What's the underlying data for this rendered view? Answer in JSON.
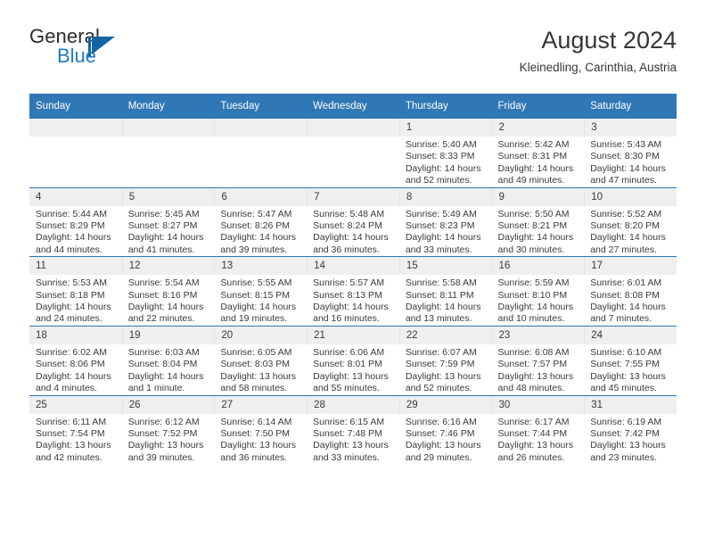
{
  "brand": {
    "name_top": "General",
    "name_bottom": "Blue",
    "logo_icon": "triangle-flag-icon",
    "accent_color": "#1f7ac4"
  },
  "header": {
    "title": "August 2024",
    "subtitle": "Kleinedling, Carinthia, Austria"
  },
  "theme": {
    "header_blue": "#3077b5",
    "daynum_gray": "#efefef",
    "text_color": "#3a3a3a"
  },
  "weekday_headers": [
    "Sunday",
    "Monday",
    "Tuesday",
    "Wednesday",
    "Thursday",
    "Friday",
    "Saturday"
  ],
  "labels": {
    "sunrise_prefix": "Sunrise:",
    "sunset_prefix": "Sunset:",
    "daylight_prefix": "Daylight:"
  },
  "weeks": [
    [
      {
        "day": "",
        "blank": true
      },
      {
        "day": "",
        "blank": true
      },
      {
        "day": "",
        "blank": true
      },
      {
        "day": "",
        "blank": true
      },
      {
        "day": "1",
        "sunrise": "Sunrise: 5:40 AM",
        "sunset": "Sunset: 8:33 PM",
        "daylight_l1": "Daylight: 14 hours",
        "daylight_l2": "and 52 minutes."
      },
      {
        "day": "2",
        "sunrise": "Sunrise: 5:42 AM",
        "sunset": "Sunset: 8:31 PM",
        "daylight_l1": "Daylight: 14 hours",
        "daylight_l2": "and 49 minutes."
      },
      {
        "day": "3",
        "sunrise": "Sunrise: 5:43 AM",
        "sunset": "Sunset: 8:30 PM",
        "daylight_l1": "Daylight: 14 hours",
        "daylight_l2": "and 47 minutes."
      }
    ],
    [
      {
        "day": "4",
        "sunrise": "Sunrise: 5:44 AM",
        "sunset": "Sunset: 8:29 PM",
        "daylight_l1": "Daylight: 14 hours",
        "daylight_l2": "and 44 minutes."
      },
      {
        "day": "5",
        "sunrise": "Sunrise: 5:45 AM",
        "sunset": "Sunset: 8:27 PM",
        "daylight_l1": "Daylight: 14 hours",
        "daylight_l2": "and 41 minutes."
      },
      {
        "day": "6",
        "sunrise": "Sunrise: 5:47 AM",
        "sunset": "Sunset: 8:26 PM",
        "daylight_l1": "Daylight: 14 hours",
        "daylight_l2": "and 39 minutes."
      },
      {
        "day": "7",
        "sunrise": "Sunrise: 5:48 AM",
        "sunset": "Sunset: 8:24 PM",
        "daylight_l1": "Daylight: 14 hours",
        "daylight_l2": "and 36 minutes."
      },
      {
        "day": "8",
        "sunrise": "Sunrise: 5:49 AM",
        "sunset": "Sunset: 8:23 PM",
        "daylight_l1": "Daylight: 14 hours",
        "daylight_l2": "and 33 minutes."
      },
      {
        "day": "9",
        "sunrise": "Sunrise: 5:50 AM",
        "sunset": "Sunset: 8:21 PM",
        "daylight_l1": "Daylight: 14 hours",
        "daylight_l2": "and 30 minutes."
      },
      {
        "day": "10",
        "sunrise": "Sunrise: 5:52 AM",
        "sunset": "Sunset: 8:20 PM",
        "daylight_l1": "Daylight: 14 hours",
        "daylight_l2": "and 27 minutes."
      }
    ],
    [
      {
        "day": "11",
        "sunrise": "Sunrise: 5:53 AM",
        "sunset": "Sunset: 8:18 PM",
        "daylight_l1": "Daylight: 14 hours",
        "daylight_l2": "and 24 minutes."
      },
      {
        "day": "12",
        "sunrise": "Sunrise: 5:54 AM",
        "sunset": "Sunset: 8:16 PM",
        "daylight_l1": "Daylight: 14 hours",
        "daylight_l2": "and 22 minutes."
      },
      {
        "day": "13",
        "sunrise": "Sunrise: 5:55 AM",
        "sunset": "Sunset: 8:15 PM",
        "daylight_l1": "Daylight: 14 hours",
        "daylight_l2": "and 19 minutes."
      },
      {
        "day": "14",
        "sunrise": "Sunrise: 5:57 AM",
        "sunset": "Sunset: 8:13 PM",
        "daylight_l1": "Daylight: 14 hours",
        "daylight_l2": "and 16 minutes."
      },
      {
        "day": "15",
        "sunrise": "Sunrise: 5:58 AM",
        "sunset": "Sunset: 8:11 PM",
        "daylight_l1": "Daylight: 14 hours",
        "daylight_l2": "and 13 minutes."
      },
      {
        "day": "16",
        "sunrise": "Sunrise: 5:59 AM",
        "sunset": "Sunset: 8:10 PM",
        "daylight_l1": "Daylight: 14 hours",
        "daylight_l2": "and 10 minutes."
      },
      {
        "day": "17",
        "sunrise": "Sunrise: 6:01 AM",
        "sunset": "Sunset: 8:08 PM",
        "daylight_l1": "Daylight: 14 hours",
        "daylight_l2": "and 7 minutes."
      }
    ],
    [
      {
        "day": "18",
        "sunrise": "Sunrise: 6:02 AM",
        "sunset": "Sunset: 8:06 PM",
        "daylight_l1": "Daylight: 14 hours",
        "daylight_l2": "and 4 minutes."
      },
      {
        "day": "19",
        "sunrise": "Sunrise: 6:03 AM",
        "sunset": "Sunset: 8:04 PM",
        "daylight_l1": "Daylight: 14 hours",
        "daylight_l2": "and 1 minute."
      },
      {
        "day": "20",
        "sunrise": "Sunrise: 6:05 AM",
        "sunset": "Sunset: 8:03 PM",
        "daylight_l1": "Daylight: 13 hours",
        "daylight_l2": "and 58 minutes."
      },
      {
        "day": "21",
        "sunrise": "Sunrise: 6:06 AM",
        "sunset": "Sunset: 8:01 PM",
        "daylight_l1": "Daylight: 13 hours",
        "daylight_l2": "and 55 minutes."
      },
      {
        "day": "22",
        "sunrise": "Sunrise: 6:07 AM",
        "sunset": "Sunset: 7:59 PM",
        "daylight_l1": "Daylight: 13 hours",
        "daylight_l2": "and 52 minutes."
      },
      {
        "day": "23",
        "sunrise": "Sunrise: 6:08 AM",
        "sunset": "Sunset: 7:57 PM",
        "daylight_l1": "Daylight: 13 hours",
        "daylight_l2": "and 48 minutes."
      },
      {
        "day": "24",
        "sunrise": "Sunrise: 6:10 AM",
        "sunset": "Sunset: 7:55 PM",
        "daylight_l1": "Daylight: 13 hours",
        "daylight_l2": "and 45 minutes."
      }
    ],
    [
      {
        "day": "25",
        "sunrise": "Sunrise: 6:11 AM",
        "sunset": "Sunset: 7:54 PM",
        "daylight_l1": "Daylight: 13 hours",
        "daylight_l2": "and 42 minutes."
      },
      {
        "day": "26",
        "sunrise": "Sunrise: 6:12 AM",
        "sunset": "Sunset: 7:52 PM",
        "daylight_l1": "Daylight: 13 hours",
        "daylight_l2": "and 39 minutes."
      },
      {
        "day": "27",
        "sunrise": "Sunrise: 6:14 AM",
        "sunset": "Sunset: 7:50 PM",
        "daylight_l1": "Daylight: 13 hours",
        "daylight_l2": "and 36 minutes."
      },
      {
        "day": "28",
        "sunrise": "Sunrise: 6:15 AM",
        "sunset": "Sunset: 7:48 PM",
        "daylight_l1": "Daylight: 13 hours",
        "daylight_l2": "and 33 minutes."
      },
      {
        "day": "29",
        "sunrise": "Sunrise: 6:16 AM",
        "sunset": "Sunset: 7:46 PM",
        "daylight_l1": "Daylight: 13 hours",
        "daylight_l2": "and 29 minutes."
      },
      {
        "day": "30",
        "sunrise": "Sunrise: 6:17 AM",
        "sunset": "Sunset: 7:44 PM",
        "daylight_l1": "Daylight: 13 hours",
        "daylight_l2": "and 26 minutes."
      },
      {
        "day": "31",
        "sunrise": "Sunrise: 6:19 AM",
        "sunset": "Sunset: 7:42 PM",
        "daylight_l1": "Daylight: 13 hours",
        "daylight_l2": "and 23 minutes."
      }
    ]
  ]
}
